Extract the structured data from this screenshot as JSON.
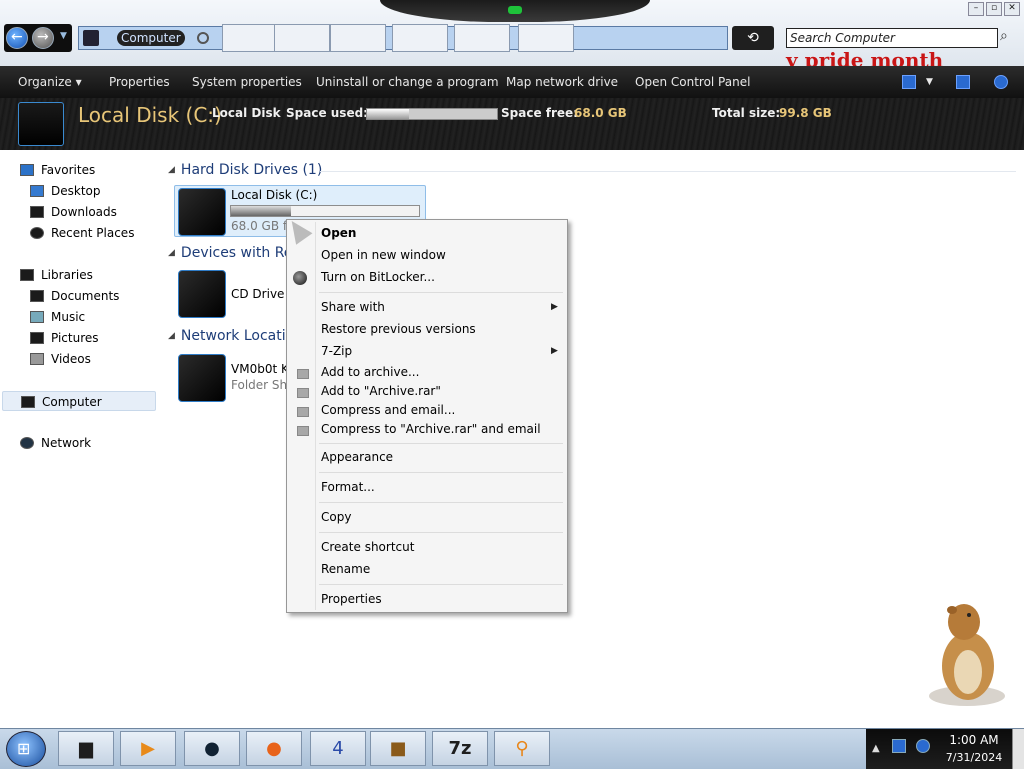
{
  "window": {
    "breadcrumb": "Computer",
    "search_placeholder": "Search Computer",
    "desktop_banner": "y pride month"
  },
  "toolbar": {
    "organize": "Organize",
    "properties": "Properties",
    "system_properties": "System properties",
    "uninstall": "Uninstall or change a program",
    "map_drive": "Map network drive",
    "control_panel": "Open Control Panel"
  },
  "details": {
    "title": "Local Disk (C:)",
    "type": "Local Disk",
    "space_used_label": "Space used:",
    "space_used_fraction": 0.32,
    "space_free_label": "Space free:",
    "space_free": "68.0 GB",
    "total_label": "Total size:",
    "total": "99.8 GB"
  },
  "nav": {
    "favorites": "Favorites",
    "desktop": "Desktop",
    "downloads": "Downloads",
    "recent": "Recent Places",
    "libraries": "Libraries",
    "documents": "Documents",
    "music": "Music",
    "pictures": "Pictures",
    "videos": "Videos",
    "computer": "Computer",
    "network": "Network"
  },
  "content": {
    "hdd_header": "Hard Disk Drives (1)",
    "drive_name": "Local Disk (C:)",
    "drive_free": "68.0 GB fre",
    "devices_header": "Devices with Re",
    "cd_name": "CD Drive (",
    "network_header": "Network Locatio",
    "net_name": "VM0b0t Ke",
    "net_sub": "Folder Sho"
  },
  "context_menu": {
    "open": "Open",
    "open_new": "Open in new window",
    "bitlocker": "Turn on BitLocker...",
    "share": "Share with",
    "restore": "Restore previous versions",
    "sevenzip": "7-Zip",
    "add_archive": "Add to archive...",
    "add_rar": "Add to \"Archive.rar\"",
    "compress_email": "Compress and email...",
    "compress_rar_email": "Compress to \"Archive.rar\" and email",
    "appearance": "Appearance",
    "format": "Format...",
    "copy": "Copy",
    "shortcut": "Create shortcut",
    "rename": "Rename",
    "properties": "Properties"
  },
  "taskbar": {
    "time": "1:00 AM",
    "date": "7/31/2024"
  }
}
